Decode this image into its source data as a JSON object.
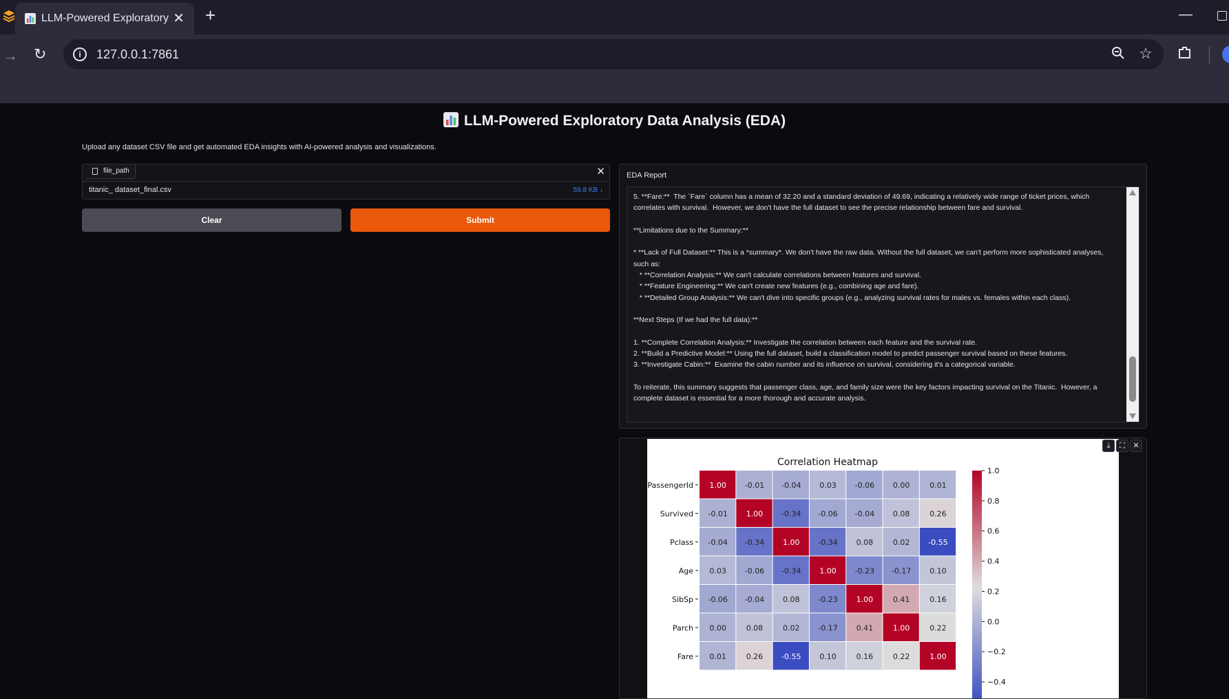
{
  "browser": {
    "tab_title": "LLM-Powered Exploratory D",
    "url": "127.0.0.1:7861",
    "icons": [
      "browser-logo-icon",
      "tab-favicon-chart-icon",
      "close-icon",
      "plus-icon",
      "minimize-icon",
      "maximize-icon",
      "forward-arrow-icon",
      "reload-icon",
      "site-info-icon",
      "zoom-icon",
      "star-icon",
      "extensions-icon",
      "profile-avatar"
    ]
  },
  "app": {
    "title": "LLM-Powered Exploratory Data Analysis (EDA)",
    "description": "Upload any dataset CSV file and get automated EDA insights with AI-powered analysis and visualizations."
  },
  "file_input": {
    "label": "file_path",
    "file_name": "titanic_ dataset_final.csv",
    "file_size": "59.8 KB ↓"
  },
  "buttons": {
    "clear": "Clear",
    "submit": "Submit"
  },
  "report": {
    "label": "EDA Report",
    "text": "5. **Fare:**  The `Fare` column has a mean of 32.20 and a standard deviation of 49.69, indicating a relatively wide range of ticket prices, which correlates with survival.  However, we don't have the full dataset to see the precise relationship between fare and survival.\n\n**Limitations due to the Summary:**\n\n* **Lack of Full Dataset:** This is a *summary*. We don't have the raw data. Without the full dataset, we can't perform more sophisticated analyses, such as:\n   * **Correlation Analysis:** We can't calculate correlations between features and survival.\n   * **Feature Engineering:** We can't create new features (e.g., combining age and fare).\n   * **Detailed Group Analysis:** We can't dive into specific groups (e.g., analyzing survival rates for males vs. females within each class).\n\n**Next Steps (If we had the full data):**\n\n1. **Complete Correlation Analysis:** Investigate the correlation between each feature and the survival rate.\n2. **Build a Predictive Model:** Using the full dataset, build a classification model to predict passenger survival based on these features.\n3. **Investigate Cabin:**  Examine the cabin number and its influence on survival, considering it's a categorical variable.\n\nTo reiterate, this summary suggests that passenger class, age, and family size were the key factors impacting survival on the Titanic.  However, a complete dataset is essential for a more thorough and accurate analysis."
  },
  "colors": {
    "accent": "#ea580c",
    "neutral_button": "#4b4b55",
    "link": "#3d7cf0"
  },
  "chart_data": {
    "type": "heatmap",
    "title": "Correlation Heatmap",
    "rows": [
      "PassengerId",
      "Survived",
      "Pclass",
      "Age",
      "SibSp",
      "Parch",
      "Fare"
    ],
    "cols": [
      "PassengerId",
      "Survived",
      "Pclass",
      "Age",
      "SibSp",
      "Parch",
      "Fare"
    ],
    "values": [
      [
        1.0,
        -0.01,
        -0.04,
        0.03,
        -0.06,
        -0.0,
        0.01
      ],
      [
        -0.01,
        1.0,
        -0.34,
        -0.06,
        -0.04,
        0.08,
        0.26
      ],
      [
        -0.04,
        -0.34,
        1.0,
        -0.34,
        0.08,
        0.02,
        -0.55
      ],
      [
        0.03,
        -0.06,
        -0.34,
        1.0,
        -0.23,
        -0.17,
        0.1
      ],
      [
        -0.06,
        -0.04,
        0.08,
        -0.23,
        1.0,
        0.41,
        0.16
      ],
      [
        -0.0,
        0.08,
        0.02,
        -0.17,
        0.41,
        1.0,
        0.22
      ],
      [
        0.01,
        0.26,
        -0.55,
        0.1,
        0.16,
        0.22,
        1.0
      ]
    ],
    "colormap": "coolwarm",
    "colorbar_ticks": [
      "1.0",
      "0.8",
      "0.6",
      "0.4",
      "0.2",
      "0.0",
      "−0.2",
      "−0.4"
    ],
    "colorbar_tick_values": [
      1.0,
      0.8,
      0.6,
      0.4,
      0.2,
      0.0,
      -0.2,
      -0.4
    ],
    "vmin": -0.55,
    "vmax": 1.0,
    "tools": [
      "download-icon",
      "fullscreen-icon",
      "close-icon"
    ]
  }
}
